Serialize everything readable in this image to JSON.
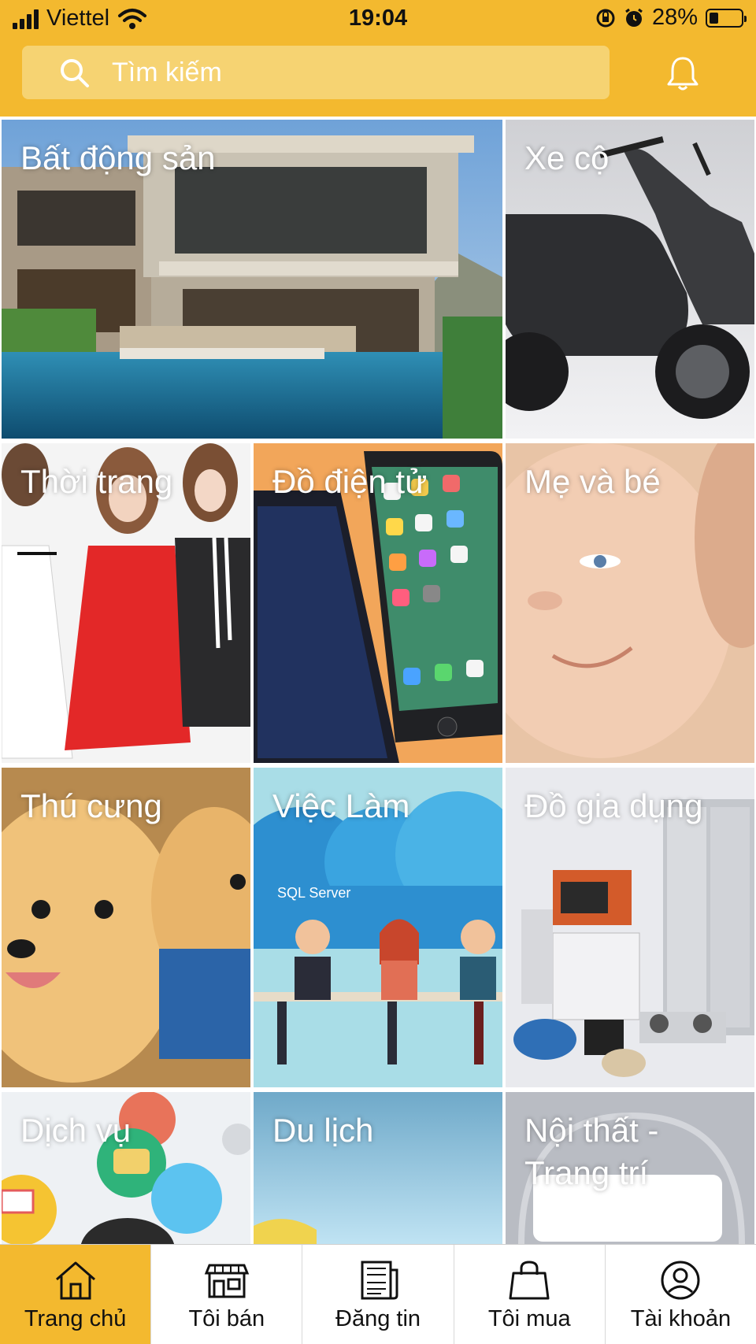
{
  "status_bar": {
    "carrier": "Viettel",
    "time": "19:04",
    "battery_percent": "28%",
    "battery_level": 0.28,
    "icons": [
      "signal-icon",
      "wifi-icon",
      "orientation-lock-icon",
      "alarm-icon",
      "battery-icon"
    ]
  },
  "search": {
    "placeholder": "Tìm kiếm",
    "icon": "search-icon"
  },
  "header": {
    "notification_icon": "bell-icon"
  },
  "categories": [
    {
      "label": "Bất động sản"
    },
    {
      "label": "Xe cộ"
    },
    {
      "label": "Thời trang"
    },
    {
      "label": "Đồ điện tử"
    },
    {
      "label": "Mẹ và bé"
    },
    {
      "label": "Thú cưng"
    },
    {
      "label": "Việc Làm"
    },
    {
      "label": "Đồ gia dụng"
    },
    {
      "label": "Dịch vụ"
    },
    {
      "label": "Du lịch"
    },
    {
      "label": "Nội thất - Trang trí"
    }
  ],
  "images": {
    "job_image_text": "SQL Server"
  },
  "tabbar": {
    "active_index": 0,
    "active_color": "#f3b92f",
    "items": [
      {
        "label": "Trang chủ",
        "icon": "home-icon"
      },
      {
        "label": "Tôi bán",
        "icon": "store-icon"
      },
      {
        "label": "Đăng tin",
        "icon": "newspaper-icon"
      },
      {
        "label": "Tôi mua",
        "icon": "shopping-bag-icon"
      },
      {
        "label": "Tài khoản",
        "icon": "user-icon"
      }
    ]
  },
  "colors": {
    "brand_yellow": "#f3b92f",
    "search_bg": "#f6d372"
  }
}
